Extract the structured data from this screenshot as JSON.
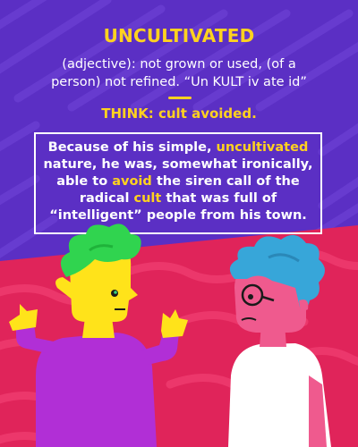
{
  "word": "UNCULTIVATED",
  "definition": {
    "line1": "(adjective):  not grown or used, (of a",
    "line2": "person) not refined.  “Un KULT iv ate id”"
  },
  "think": "THINK: cult avoided.",
  "sentence": {
    "p1": "Because of his simple, ",
    "h1": "uncultivated",
    "p2": " nature, he was, somewhat ironically, able to ",
    "h2": "avoid",
    "p3": " the siren call of the radical ",
    "h3": "cult",
    "p4": " that was full of “intelligent” people from his town."
  },
  "colors": {
    "top_background": "#5b2fc4",
    "bottom_background": "#e0245a",
    "accent": "#ffd21f",
    "text": "#ffffff"
  }
}
